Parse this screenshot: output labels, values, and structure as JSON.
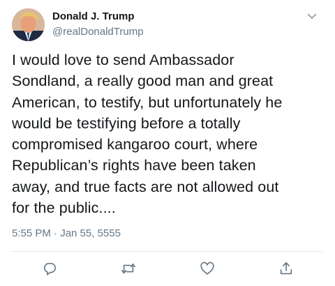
{
  "author": {
    "name": "Donald J. Trump",
    "handle": "@realDonaldTrump"
  },
  "tweet": {
    "lines": [
      "I would love to send Ambassador",
      "Sondland, a really good man and great",
      "American, to testify, but unfortunately he",
      "would be testifying before a totally",
      "compromised kangaroo court, where",
      "Republican’s rights have been taken",
      "away, and true facts are not allowed out",
      "for the public...."
    ],
    "timestamp": "5:55 PM · Jan 55, 5555"
  },
  "icons": {
    "menu": "chevron-down-icon",
    "reply": "reply-icon",
    "retweet": "retweet-icon",
    "like": "heart-icon",
    "share": "share-icon"
  },
  "colors": {
    "text": "#14171a",
    "secondary": "#657786",
    "divider": "#e1e8ed",
    "icon": "#657786"
  }
}
